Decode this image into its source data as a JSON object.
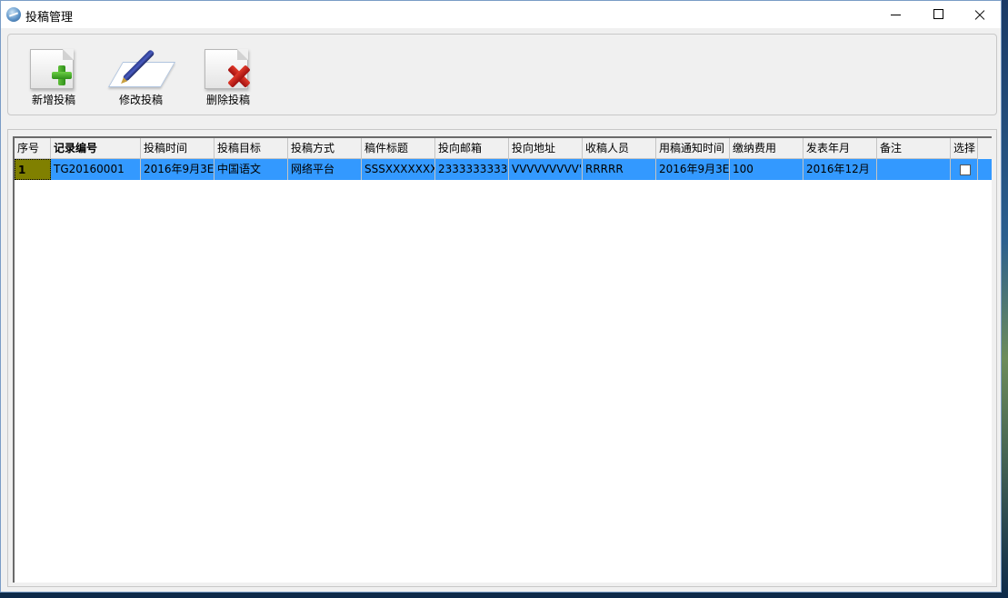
{
  "window": {
    "title": "投稿管理"
  },
  "titlebar_buttons": {
    "minimize": "minimize-icon",
    "maximize": "maximize-icon",
    "close": "close-icon"
  },
  "toolbar": {
    "add_label": "新增投稿",
    "edit_label": "修改投稿",
    "delete_label": "删除投稿"
  },
  "grid": {
    "columns": [
      "序号",
      "记录编号",
      "投稿时间",
      "投稿目标",
      "投稿方式",
      "稿件标题",
      "投向邮箱",
      "投向地址",
      "收稿人员",
      "用稿通知时间",
      "缴纳费用",
      "发表年月",
      "备注",
      "选择"
    ],
    "rows": [
      {
        "index": "1",
        "record_no": "TG20160001",
        "submit_time": "2016年9月3E",
        "target": "中国语文",
        "method": "网络平台",
        "title": "SSSXXXXXXX",
        "email": "2333333333",
        "address": "VVVVVVVVV'",
        "receiver": "RRRRR",
        "notice_time": "2016年9月3E",
        "fee": "100",
        "publish_date": "2016年12月",
        "remark": "",
        "selected": false
      }
    ]
  },
  "colors": {
    "selection": "#3399ff",
    "rownum_bg": "#808000",
    "window_bg": "#f0f0f0"
  }
}
